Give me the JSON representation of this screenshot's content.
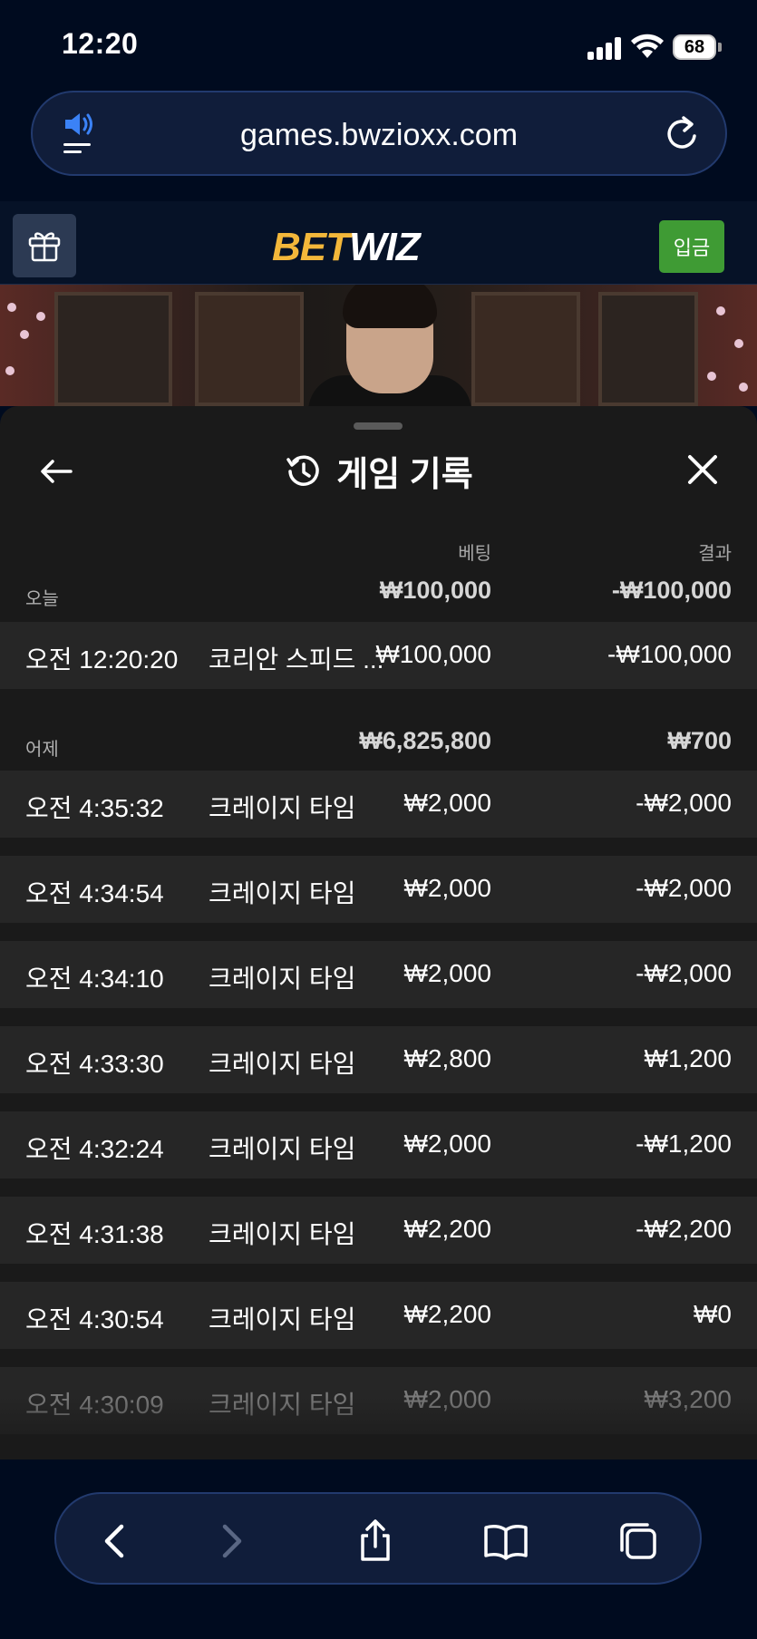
{
  "status": {
    "time": "12:20",
    "battery": "68"
  },
  "browser": {
    "url": "games.bwzioxx.com"
  },
  "site": {
    "logo_bet": "BET",
    "logo_wiz": "WIZ",
    "deposit_label": "입금"
  },
  "panel": {
    "title": "게임 기록",
    "col_bet": "베팅",
    "col_result": "결과",
    "groups": [
      {
        "label": "오늘",
        "bet_total": "₩100,000",
        "result_total": "-₩100,000",
        "rows": [
          {
            "time": "오전 12:20:20",
            "game": "코리안 스피드 ...",
            "bet": "₩100,000",
            "result": "-₩100,000"
          }
        ]
      },
      {
        "label": "어제",
        "bet_total": "₩6,825,800",
        "result_total": "₩700",
        "rows": [
          {
            "time": "오전 4:35:32",
            "game": "크레이지 타임",
            "bet": "₩2,000",
            "result": "-₩2,000"
          },
          {
            "time": "오전 4:34:54",
            "game": "크레이지 타임",
            "bet": "₩2,000",
            "result": "-₩2,000"
          },
          {
            "time": "오전 4:34:10",
            "game": "크레이지 타임",
            "bet": "₩2,000",
            "result": "-₩2,000"
          },
          {
            "time": "오전 4:33:30",
            "game": "크레이지 타임",
            "bet": "₩2,800",
            "result": "₩1,200"
          },
          {
            "time": "오전 4:32:24",
            "game": "크레이지 타임",
            "bet": "₩2,000",
            "result": "-₩1,200"
          },
          {
            "time": "오전 4:31:38",
            "game": "크레이지 타임",
            "bet": "₩2,200",
            "result": "-₩2,200"
          },
          {
            "time": "오전 4:30:54",
            "game": "크레이지 타임",
            "bet": "₩2,200",
            "result": "₩0"
          },
          {
            "time": "오전 4:30:09",
            "game": "크레이지 타임",
            "bet": "₩2,000",
            "result": "₩3,200"
          }
        ]
      }
    ]
  },
  "colors": {
    "accent_gold": "#f3b73a",
    "deposit_green": "#3f9b34",
    "panel_bg": "#1a1a1a",
    "row_bg": "#262626"
  },
  "icons": [
    "speaker-icon",
    "reload-icon",
    "gift-icon",
    "back-arrow-icon",
    "history-icon",
    "close-icon",
    "chevron-left-icon",
    "chevron-right-icon",
    "share-icon",
    "bookmarks-icon",
    "tabs-icon"
  ]
}
